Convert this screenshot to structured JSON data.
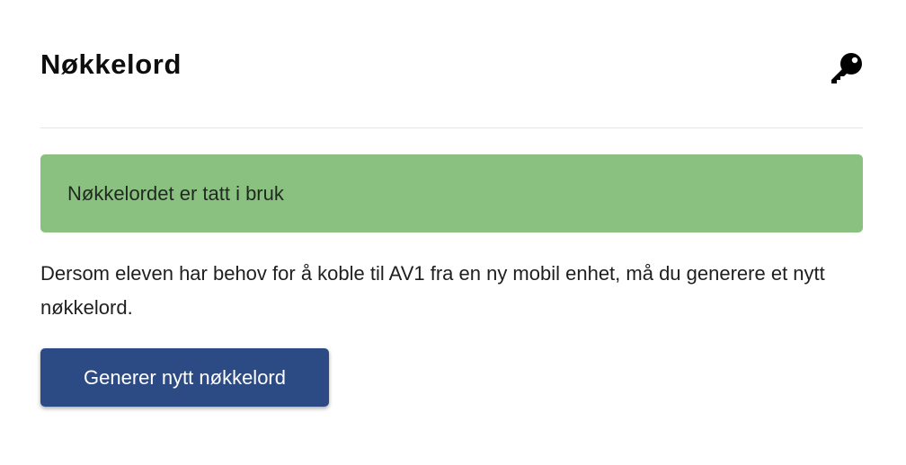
{
  "header": {
    "title": "Nøkkelord",
    "icon": "key-icon"
  },
  "alert": {
    "text": "Nøkkelordet er tatt i bruk",
    "color": "#8bc180"
  },
  "description": "Dersom eleven har behov for å koble til AV1 fra en ny mobil enhet, må du generere et nytt nøkkelord.",
  "button": {
    "label": "Generer nytt nøkkelord",
    "color": "#2c4a83"
  }
}
